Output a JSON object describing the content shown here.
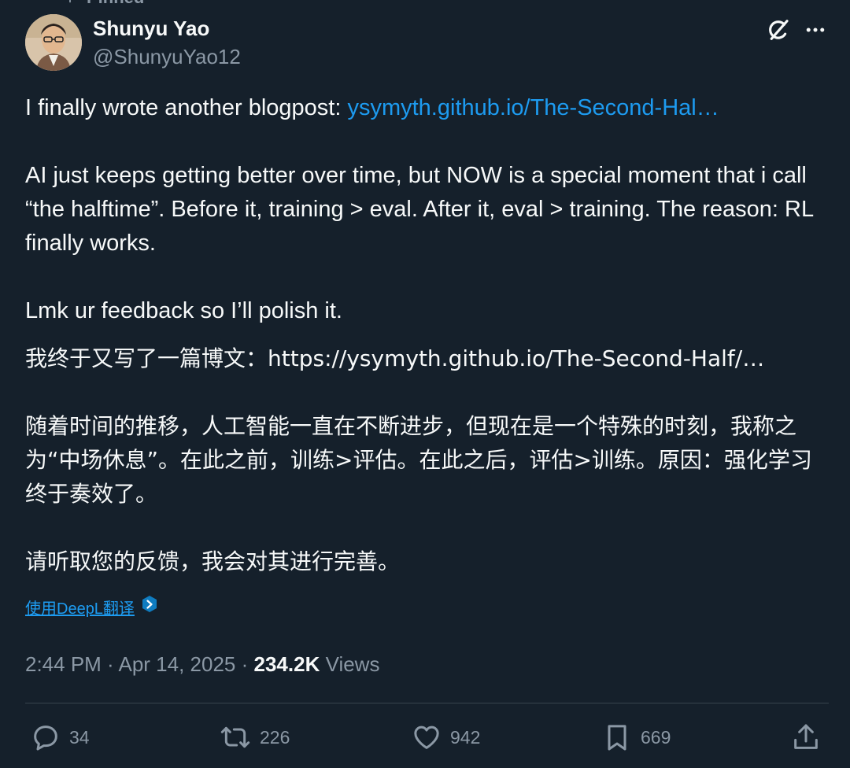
{
  "pinned": {
    "label": "Pinned"
  },
  "author": {
    "name": "Shunyu Yao",
    "handle": "@ShunyuYao12"
  },
  "tweet": {
    "en_intro": "I finally wrote another blogpost: ",
    "en_link": "ysymyth.github.io/The-Second-Hal…",
    "en_para2": "AI just keeps getting better over time, but NOW is a special moment that i call “the halftime”. Before it, training > eval. After it, eval > training. The reason: RL finally works.",
    "en_para3": "Lmk ur feedback so I’ll polish it.",
    "zh_para1": "我终于又写了一篇博文：https://ysymyth.github.io/The-Second-Half/…",
    "zh_para2": "随着时间的推移，人工智能一直在不断进步，但现在是一个特殊的时刻，我称之为“中场休息”。在此之前，训练>评估。在此之后，评估>训练。原因：强化学习终于奏效了。",
    "zh_para3": "请听取您的反馈，我会对其进行完善。"
  },
  "translate": {
    "label": "使用DeepL翻译"
  },
  "meta": {
    "time": "2:44 PM",
    "separator": " · ",
    "date": "Apr 14, 2025",
    "views_count": "234.2K",
    "views_label": "Views"
  },
  "actions": {
    "replies": "34",
    "retweets": "226",
    "likes": "942",
    "bookmarks": "669"
  },
  "colors": {
    "background": "#15202b",
    "text": "#f7f9f9",
    "secondary": "#8b98a5",
    "link": "#1d9bf0",
    "divider": "#38444d"
  },
  "icons": {
    "pinned": "pin-icon",
    "grok": "grok-icon",
    "more": "more-icon",
    "reply": "reply-icon",
    "retweet": "retweet-icon",
    "like": "heart-icon",
    "bookmark": "bookmark-icon",
    "share": "share-icon",
    "deepl": "deepl-icon"
  }
}
